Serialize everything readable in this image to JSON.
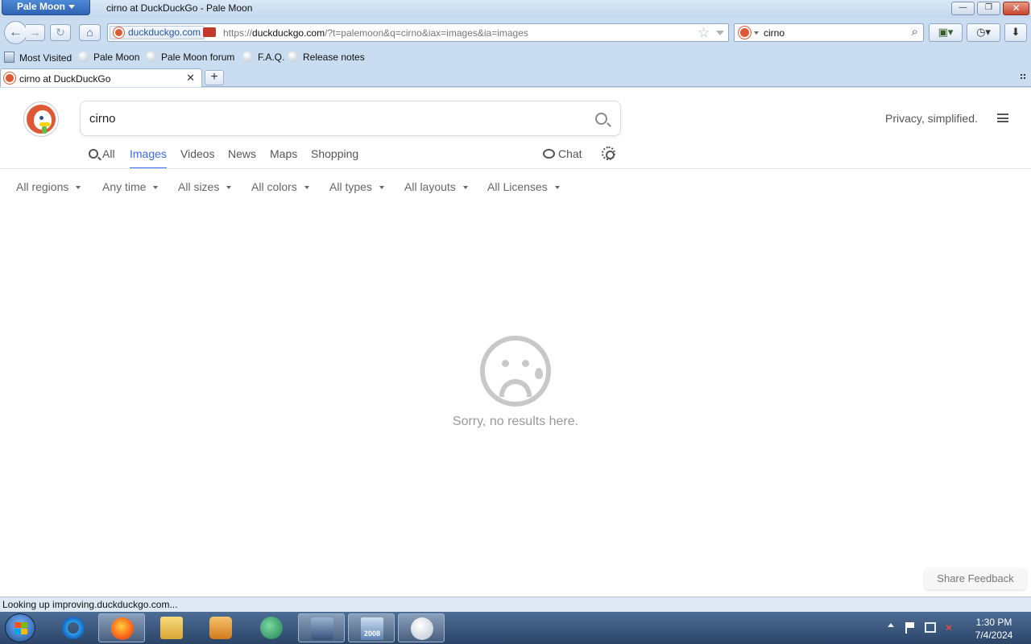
{
  "window": {
    "app_button": "Pale Moon",
    "title": "cirno at DuckDuckGo - Pale Moon",
    "minimize": "—",
    "maximize": "❐",
    "close": "✕"
  },
  "navigation": {
    "back_icon": "arrow-left-icon",
    "forward_icon": "arrow-right-icon",
    "reload_icon": "reload-icon",
    "home_icon": "home-icon",
    "identity": "duckduckgo.com",
    "url_prefix": "https://",
    "url_host": "duckduckgo.com",
    "url_rest": "/?t=palemoon&q=cirno&iax=images&ia=images",
    "search_value": "cirno"
  },
  "bookmarks": [
    {
      "label": "Most Visited"
    },
    {
      "label": "Pale Moon"
    },
    {
      "label": "Pale Moon forum"
    },
    {
      "label": "F.A.Q."
    },
    {
      "label": "Release notes"
    }
  ],
  "tabs": [
    {
      "label": "cirno at DuckDuckGo",
      "active": true
    }
  ],
  "page": {
    "search_value": "cirno",
    "privacy_tagline": "Privacy, simplified.",
    "nav_tabs": [
      "All",
      "Images",
      "Videos",
      "News",
      "Maps",
      "Shopping"
    ],
    "active_nav_tab": "Images",
    "chat_label": "Chat",
    "filters": [
      "All regions",
      "Any time",
      "All sizes",
      "All colors",
      "All types",
      "All layouts",
      "All Licenses"
    ],
    "empty_message": "Sorry, no results here.",
    "feedback_label": "Share Feedback",
    "accent_color": "#3969ef",
    "brand_color": "#de5833"
  },
  "status": {
    "text": "Looking up improving.duckduckgo.com..."
  },
  "taskbar": {
    "apps": [
      "internet-explorer",
      "firefox",
      "file-explorer",
      "media-player",
      "vlc-like",
      "virtualbox",
      "sql-server-2008",
      "pale-moon"
    ],
    "sql_badge": "2008",
    "time": "1:30 PM",
    "date": "7/4/2024"
  }
}
